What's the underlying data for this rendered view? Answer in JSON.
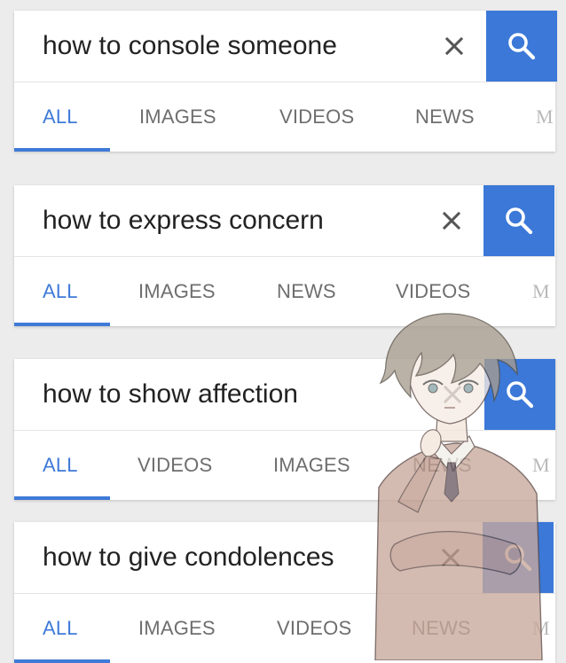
{
  "panels": [
    {
      "query": "how to console someone",
      "tabs": [
        "ALL",
        "IMAGES",
        "VIDEOS",
        "NEWS",
        "M"
      ]
    },
    {
      "query": "how to express concern",
      "tabs": [
        "ALL",
        "IMAGES",
        "NEWS",
        "VIDEOS",
        "M"
      ]
    },
    {
      "query": "how to show affection",
      "tabs": [
        "ALL",
        "VIDEOS",
        "IMAGES",
        "NEWS",
        "M"
      ]
    },
    {
      "query": "how to give condolences",
      "tabs": [
        "ALL",
        "IMAGES",
        "VIDEOS",
        "NEWS",
        "M"
      ]
    }
  ],
  "icons": {
    "clear": "close-icon",
    "search": "search-icon"
  },
  "colors": {
    "accent": "#3f7ad8",
    "search_button": "#3b78d8",
    "background": "#ececec",
    "tab_text": "#6e6e6e"
  }
}
